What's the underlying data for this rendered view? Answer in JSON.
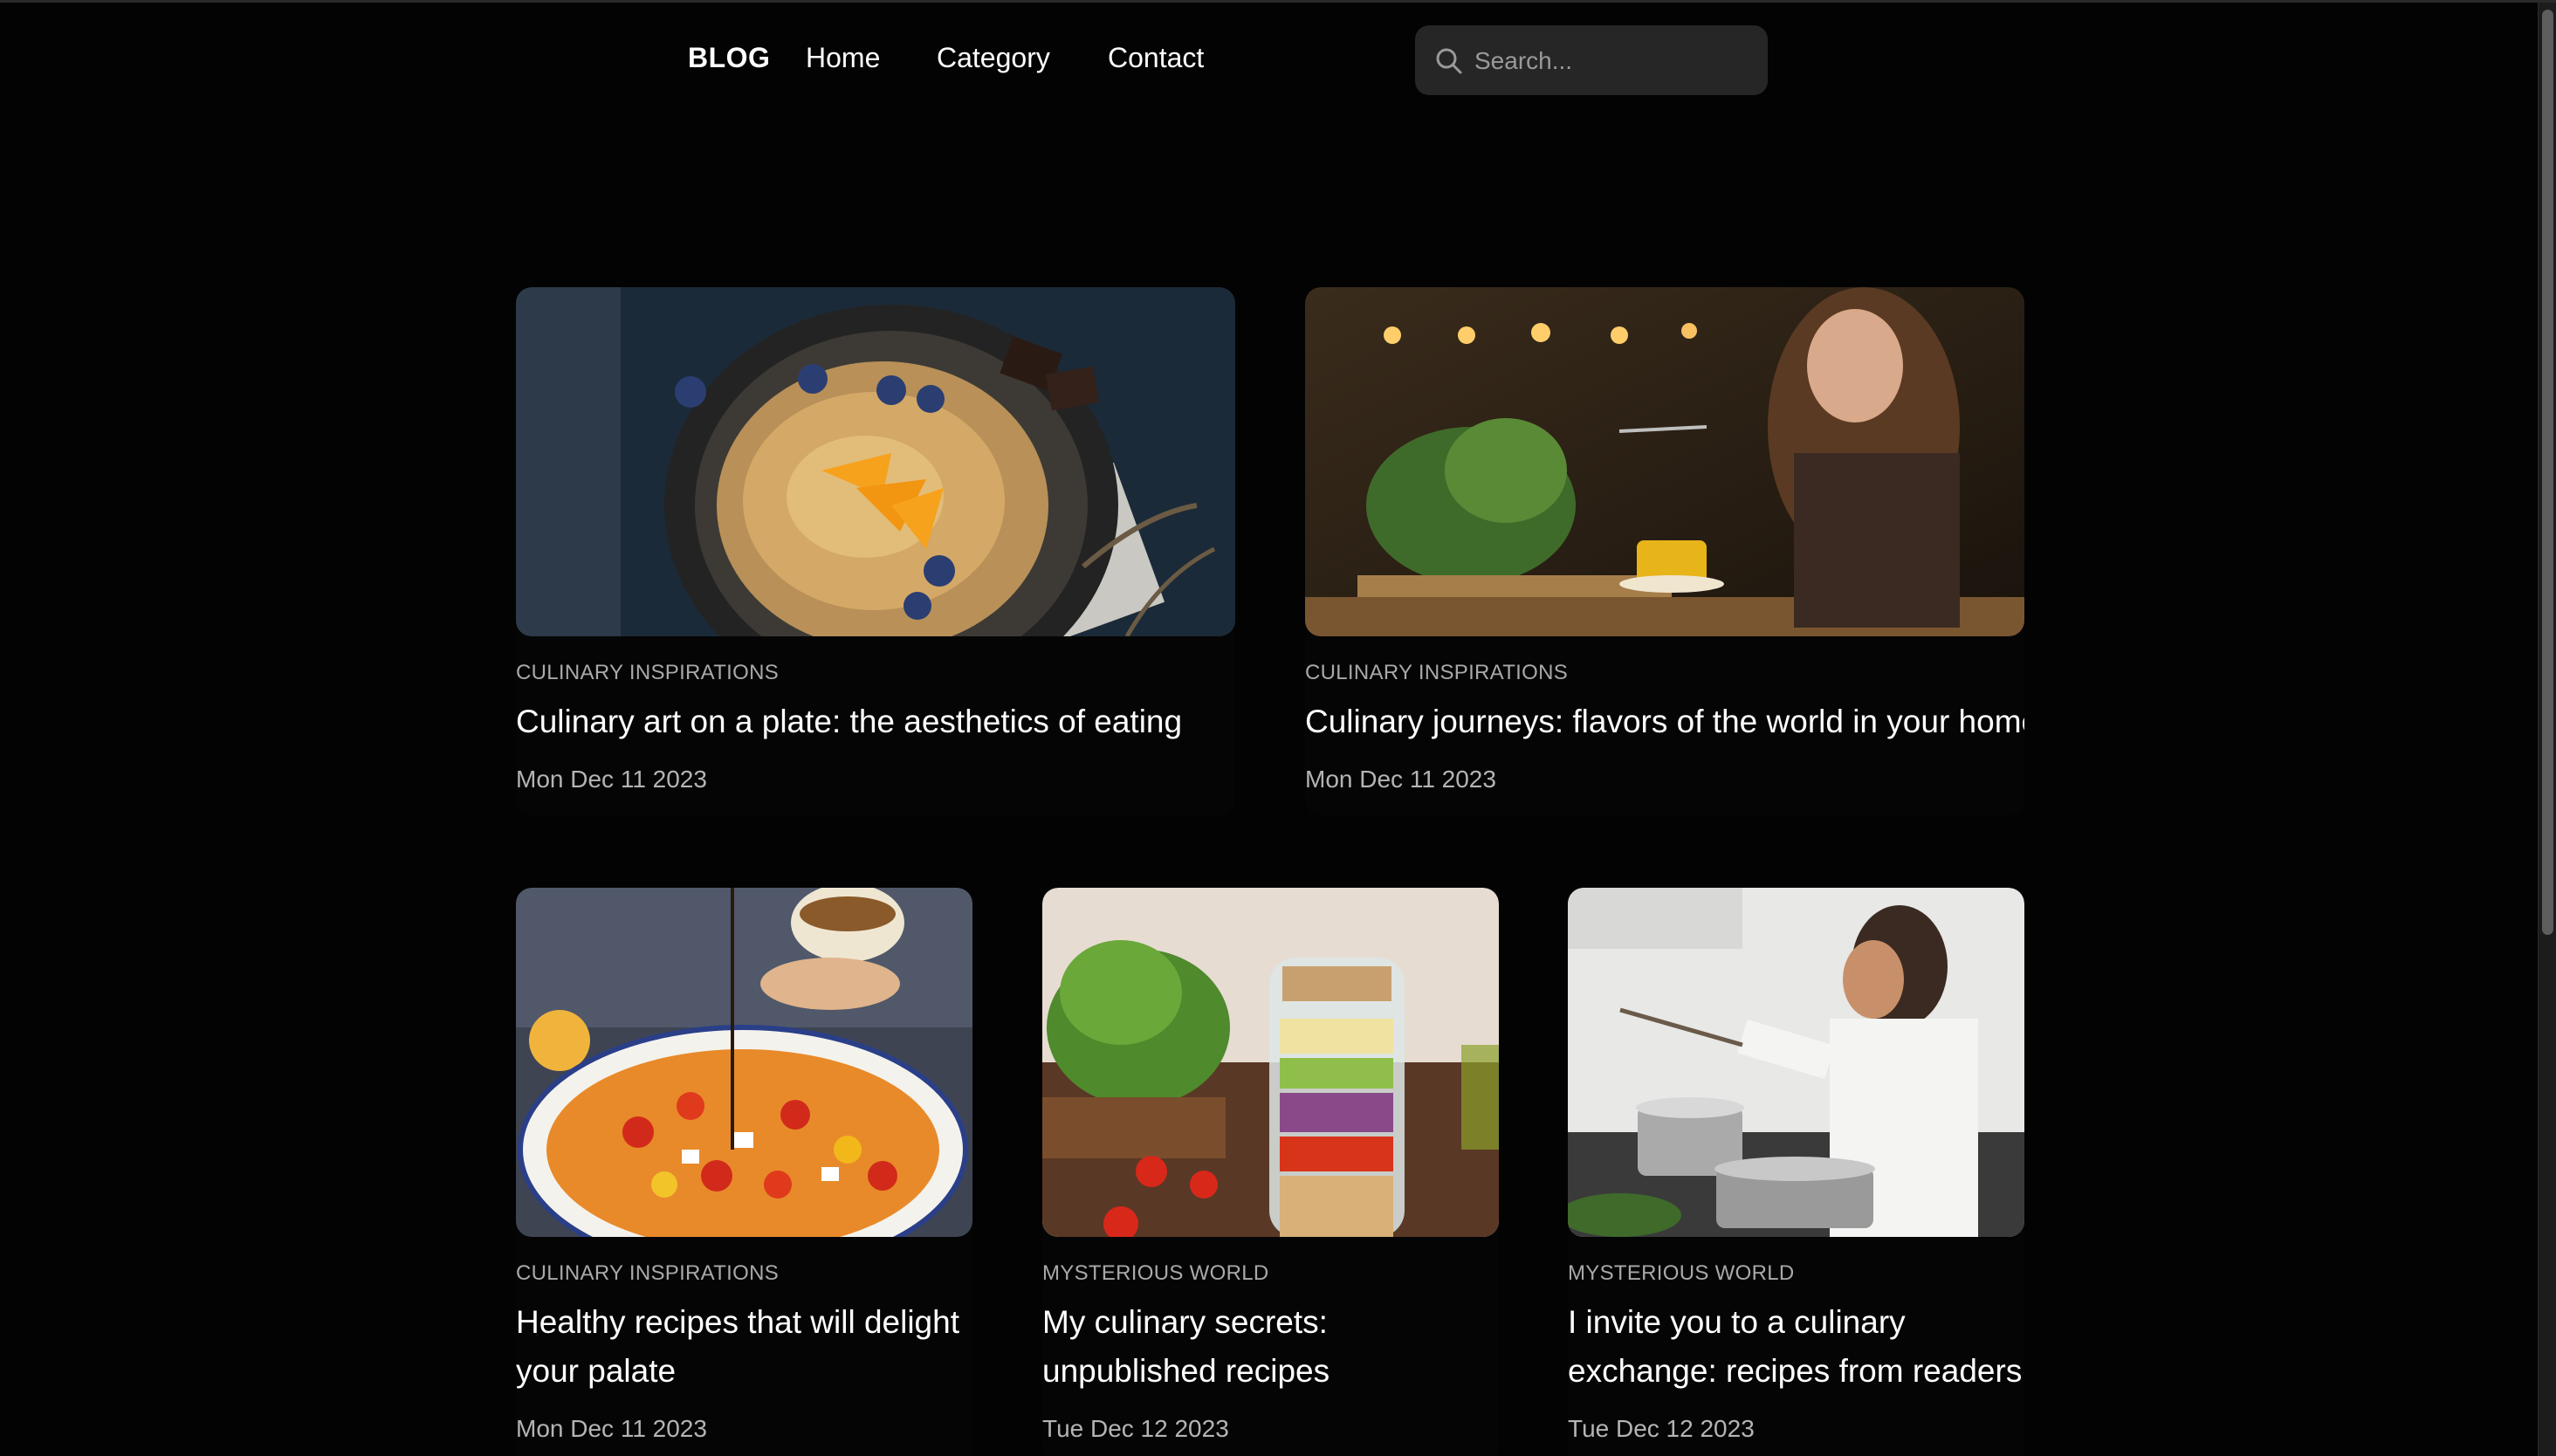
{
  "header": {
    "brand": "BLOG",
    "nav": [
      {
        "label": "Home"
      },
      {
        "label": "Category"
      },
      {
        "label": "Contact"
      }
    ],
    "search": {
      "placeholder": "Search...",
      "value": "",
      "icon": "search-icon"
    }
  },
  "posts": [
    {
      "category": "CULINARY INSPIRATIONS",
      "title": "Culinary art on a plate: the aesthetics of eating",
      "date": "Mon Dec 11 2023",
      "image": "pancakes-skillet-photo"
    },
    {
      "category": "CULINARY INSPIRATIONS",
      "title": "Culinary journeys: flavors of the world in your home",
      "date": "Mon Dec 11 2023",
      "image": "woman-dining-photo"
    },
    {
      "category": "CULINARY INSPIRATIONS",
      "title": "Healthy recipes that will delight your palate",
      "date": "Mon Dec 11 2023",
      "image": "tomato-salad-bowl-photo"
    },
    {
      "category": "MYSTERIOUS WORLD",
      "title": "My culinary secrets: unpublished recipes",
      "date": "Tue Dec 12 2023",
      "image": "salad-jar-photo"
    },
    {
      "category": "MYSTERIOUS WORLD",
      "title": "I invite you to a culinary exchange: recipes from readers",
      "date": "Tue Dec 12 2023",
      "image": "woman-cooking-photo"
    }
  ],
  "colors": {
    "background": "#030303",
    "search_bg": "#262626",
    "category_text": "#a9a9a9",
    "date_text": "#b4b4b4"
  }
}
